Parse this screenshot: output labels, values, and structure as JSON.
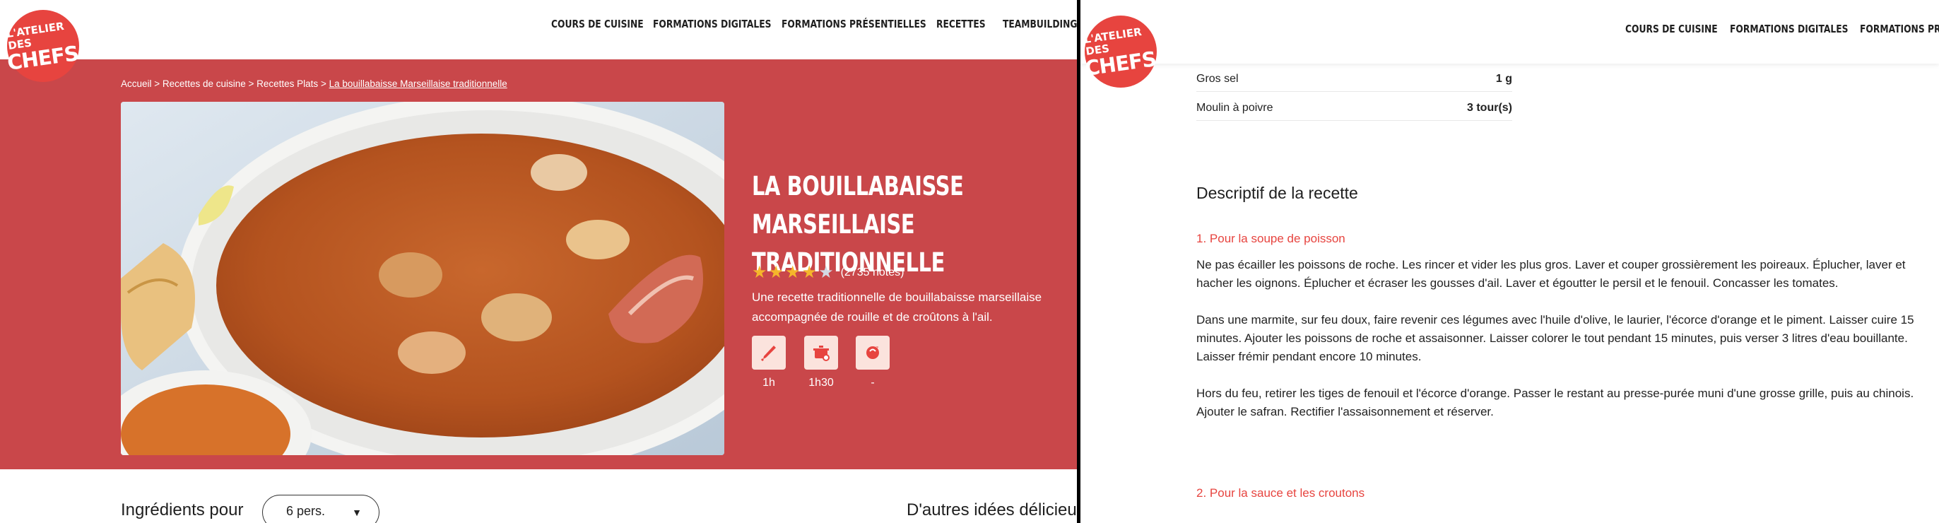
{
  "brand": {
    "logo_line1": "L'ATELIER DES",
    "logo_line2": "CHEFS",
    "accent": "#e7443f",
    "hero_bg": "#c9474a"
  },
  "nav_left": [
    "COURS DE CUISINE",
    "FORMATIONS DIGITALES",
    "FORMATIONS PRÉSENTIELLES",
    "RECETTES",
    "TEAMBUILDING"
  ],
  "nav_right": [
    "COURS DE CUISINE",
    "FORMATIONS DIGITALES",
    "FORMATIONS PRÉ"
  ],
  "breadcrumb": {
    "home": "Accueil",
    "sep": " > ",
    "cat": "Recettes de cuisine",
    "sub": "Recettes Plats",
    "current": "La bouillabaisse Marseillaise traditionnelle"
  },
  "recipe": {
    "title_line1": "LA BOUILLABAISSE MARSEILLAISE",
    "title_line2": "TRADITIONNELLE",
    "rating": 4,
    "rating_count": "(2735 notes)",
    "description": "Une recette traditionnelle de bouillabaisse marseillaise accompagnée de rouille et de croûtons à l'ail.",
    "meta": [
      {
        "icon": "knife-icon",
        "label": "1h"
      },
      {
        "icon": "pot-icon",
        "label": "1h30"
      },
      {
        "icon": "chef-hat-icon",
        "label": "-"
      }
    ]
  },
  "ingredients": {
    "label": "Ingrédients pour",
    "portion": "6 pers.",
    "rows": [
      {
        "name": "Gros sel",
        "qty": "1 g"
      },
      {
        "name": "Moulin à poivre",
        "qty": "3 tour(s)"
      }
    ]
  },
  "sidebar_heading": "D'autres idées délicieu",
  "steps_section": {
    "title": "Descriptif de la recette",
    "step1_title": "1. Pour la soupe de poisson",
    "step1_p1": "Ne pas écailler les poissons de roche. Les rincer et vider les plus gros. Laver et couper grossièrement les poireaux. Éplucher, laver et hacher les oignons. Éplucher et écraser les gousses d'ail. Laver et égoutter le persil et le fenouil. Concasser les tomates.",
    "step1_p2a": "Dans une marmite, sur feu doux, faire revenir ces légumes avec l'huile d'olive, le laurier, l'écorce d'orange et le piment. Laisser cuire 15 minutes. Ajouter les poissons de roche et assaisonner. Laisser colorer le tout pendant 15 minutes, puis verser 3 litres d'eau bouillante.",
    "step1_p2b": "Laisser frémir pendant encore 10 minutes.",
    "step1_p3a": "Hors du feu, retirer les tiges de fenouil et l'écorce d'orange. Passer le restant au presse-purée muni d'une grosse grille, puis au chinois.",
    "step1_p3b": "Ajouter le safran. Rectifier l'assaisonnement et réserver.",
    "step2_title": "2. Pour la sauce et les croutons"
  }
}
